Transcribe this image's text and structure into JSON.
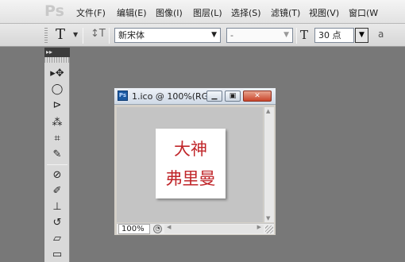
{
  "app": {
    "logo_text": "Ps"
  },
  "menubar": {
    "items": [
      "文件(F)",
      "编辑(E)",
      "图像(I)",
      "图层(L)",
      "选择(S)",
      "滤镜(T)",
      "视图(V)",
      "窗口(W"
    ]
  },
  "options": {
    "type_tool_icon": "T",
    "font_family": "新宋体",
    "font_style": "-",
    "font_size": "30 点",
    "size_icon": "T"
  },
  "document": {
    "title": "1.ico @ 100%(RG...",
    "zoom": "100%",
    "canvas_line1": "大神",
    "canvas_line2": "弗里曼",
    "canvas_text_color": "#c0262a"
  },
  "icons": {
    "ps_logo": "photoshop-logo",
    "tools": [
      "move-tool-icon",
      "lasso-tool-icon",
      "polygonal-lasso-tool-icon",
      "magic-wand-tool-icon",
      "crop-tool-icon",
      "eyedropper-tool-icon",
      "healing-brush-tool-icon",
      "brush-tool-icon",
      "clone-stamp-tool-icon",
      "history-brush-tool-icon",
      "eraser-tool-icon",
      "gradient-tool-icon"
    ]
  }
}
